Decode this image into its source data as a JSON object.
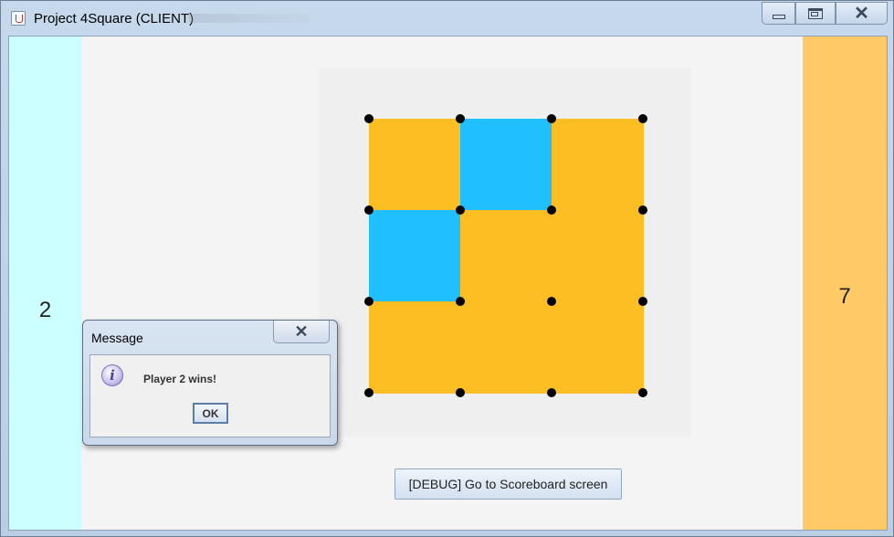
{
  "window": {
    "title": "Project 4Square (CLIENT)",
    "controls": [
      "minimize",
      "maximize",
      "close"
    ]
  },
  "scores": {
    "left": "2",
    "right": "7"
  },
  "colors": {
    "left_panel": "#ccffff",
    "right_panel": "#ffc966",
    "player_orange": "#fdbe24",
    "player_blue": "#20bfff",
    "board_bg": "#efefef",
    "dot": "#000000"
  },
  "board": {
    "rows": 3,
    "cols": 3,
    "cells": [
      [
        "orange",
        "blue",
        "orange"
      ],
      [
        "blue",
        "orange",
        "orange"
      ],
      [
        "orange",
        "orange",
        "orange"
      ]
    ]
  },
  "debug_button": {
    "label": "[DEBUG] Go to Scoreboard screen"
  },
  "dialog": {
    "title": "Message",
    "icon": "info-icon",
    "message": "Player 2 wins!",
    "ok_label": "OK"
  }
}
